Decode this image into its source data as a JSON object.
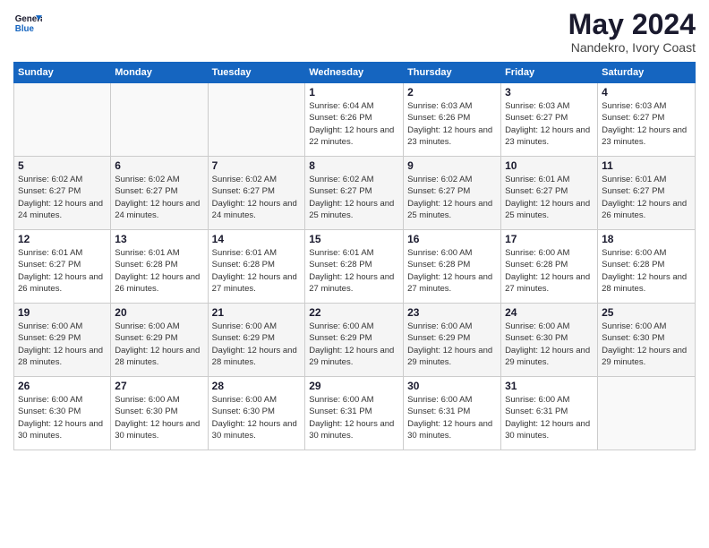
{
  "logo": {
    "text_general": "General",
    "text_blue": "Blue"
  },
  "header": {
    "month_year": "May 2024",
    "location": "Nandekro, Ivory Coast"
  },
  "weekdays": [
    "Sunday",
    "Monday",
    "Tuesday",
    "Wednesday",
    "Thursday",
    "Friday",
    "Saturday"
  ],
  "weeks": [
    [
      {
        "day": "",
        "sunrise": "",
        "sunset": "",
        "daylight": ""
      },
      {
        "day": "",
        "sunrise": "",
        "sunset": "",
        "daylight": ""
      },
      {
        "day": "",
        "sunrise": "",
        "sunset": "",
        "daylight": ""
      },
      {
        "day": "1",
        "sunrise": "Sunrise: 6:04 AM",
        "sunset": "Sunset: 6:26 PM",
        "daylight": "Daylight: 12 hours and 22 minutes."
      },
      {
        "day": "2",
        "sunrise": "Sunrise: 6:03 AM",
        "sunset": "Sunset: 6:26 PM",
        "daylight": "Daylight: 12 hours and 23 minutes."
      },
      {
        "day": "3",
        "sunrise": "Sunrise: 6:03 AM",
        "sunset": "Sunset: 6:27 PM",
        "daylight": "Daylight: 12 hours and 23 minutes."
      },
      {
        "day": "4",
        "sunrise": "Sunrise: 6:03 AM",
        "sunset": "Sunset: 6:27 PM",
        "daylight": "Daylight: 12 hours and 23 minutes."
      }
    ],
    [
      {
        "day": "5",
        "sunrise": "Sunrise: 6:02 AM",
        "sunset": "Sunset: 6:27 PM",
        "daylight": "Daylight: 12 hours and 24 minutes."
      },
      {
        "day": "6",
        "sunrise": "Sunrise: 6:02 AM",
        "sunset": "Sunset: 6:27 PM",
        "daylight": "Daylight: 12 hours and 24 minutes."
      },
      {
        "day": "7",
        "sunrise": "Sunrise: 6:02 AM",
        "sunset": "Sunset: 6:27 PM",
        "daylight": "Daylight: 12 hours and 24 minutes."
      },
      {
        "day": "8",
        "sunrise": "Sunrise: 6:02 AM",
        "sunset": "Sunset: 6:27 PM",
        "daylight": "Daylight: 12 hours and 25 minutes."
      },
      {
        "day": "9",
        "sunrise": "Sunrise: 6:02 AM",
        "sunset": "Sunset: 6:27 PM",
        "daylight": "Daylight: 12 hours and 25 minutes."
      },
      {
        "day": "10",
        "sunrise": "Sunrise: 6:01 AM",
        "sunset": "Sunset: 6:27 PM",
        "daylight": "Daylight: 12 hours and 25 minutes."
      },
      {
        "day": "11",
        "sunrise": "Sunrise: 6:01 AM",
        "sunset": "Sunset: 6:27 PM",
        "daylight": "Daylight: 12 hours and 26 minutes."
      }
    ],
    [
      {
        "day": "12",
        "sunrise": "Sunrise: 6:01 AM",
        "sunset": "Sunset: 6:27 PM",
        "daylight": "Daylight: 12 hours and 26 minutes."
      },
      {
        "day": "13",
        "sunrise": "Sunrise: 6:01 AM",
        "sunset": "Sunset: 6:28 PM",
        "daylight": "Daylight: 12 hours and 26 minutes."
      },
      {
        "day": "14",
        "sunrise": "Sunrise: 6:01 AM",
        "sunset": "Sunset: 6:28 PM",
        "daylight": "Daylight: 12 hours and 27 minutes."
      },
      {
        "day": "15",
        "sunrise": "Sunrise: 6:01 AM",
        "sunset": "Sunset: 6:28 PM",
        "daylight": "Daylight: 12 hours and 27 minutes."
      },
      {
        "day": "16",
        "sunrise": "Sunrise: 6:00 AM",
        "sunset": "Sunset: 6:28 PM",
        "daylight": "Daylight: 12 hours and 27 minutes."
      },
      {
        "day": "17",
        "sunrise": "Sunrise: 6:00 AM",
        "sunset": "Sunset: 6:28 PM",
        "daylight": "Daylight: 12 hours and 27 minutes."
      },
      {
        "day": "18",
        "sunrise": "Sunrise: 6:00 AM",
        "sunset": "Sunset: 6:28 PM",
        "daylight": "Daylight: 12 hours and 28 minutes."
      }
    ],
    [
      {
        "day": "19",
        "sunrise": "Sunrise: 6:00 AM",
        "sunset": "Sunset: 6:29 PM",
        "daylight": "Daylight: 12 hours and 28 minutes."
      },
      {
        "day": "20",
        "sunrise": "Sunrise: 6:00 AM",
        "sunset": "Sunset: 6:29 PM",
        "daylight": "Daylight: 12 hours and 28 minutes."
      },
      {
        "day": "21",
        "sunrise": "Sunrise: 6:00 AM",
        "sunset": "Sunset: 6:29 PM",
        "daylight": "Daylight: 12 hours and 28 minutes."
      },
      {
        "day": "22",
        "sunrise": "Sunrise: 6:00 AM",
        "sunset": "Sunset: 6:29 PM",
        "daylight": "Daylight: 12 hours and 29 minutes."
      },
      {
        "day": "23",
        "sunrise": "Sunrise: 6:00 AM",
        "sunset": "Sunset: 6:29 PM",
        "daylight": "Daylight: 12 hours and 29 minutes."
      },
      {
        "day": "24",
        "sunrise": "Sunrise: 6:00 AM",
        "sunset": "Sunset: 6:30 PM",
        "daylight": "Daylight: 12 hours and 29 minutes."
      },
      {
        "day": "25",
        "sunrise": "Sunrise: 6:00 AM",
        "sunset": "Sunset: 6:30 PM",
        "daylight": "Daylight: 12 hours and 29 minutes."
      }
    ],
    [
      {
        "day": "26",
        "sunrise": "Sunrise: 6:00 AM",
        "sunset": "Sunset: 6:30 PM",
        "daylight": "Daylight: 12 hours and 30 minutes."
      },
      {
        "day": "27",
        "sunrise": "Sunrise: 6:00 AM",
        "sunset": "Sunset: 6:30 PM",
        "daylight": "Daylight: 12 hours and 30 minutes."
      },
      {
        "day": "28",
        "sunrise": "Sunrise: 6:00 AM",
        "sunset": "Sunset: 6:30 PM",
        "daylight": "Daylight: 12 hours and 30 minutes."
      },
      {
        "day": "29",
        "sunrise": "Sunrise: 6:00 AM",
        "sunset": "Sunset: 6:31 PM",
        "daylight": "Daylight: 12 hours and 30 minutes."
      },
      {
        "day": "30",
        "sunrise": "Sunrise: 6:00 AM",
        "sunset": "Sunset: 6:31 PM",
        "daylight": "Daylight: 12 hours and 30 minutes."
      },
      {
        "day": "31",
        "sunrise": "Sunrise: 6:00 AM",
        "sunset": "Sunset: 6:31 PM",
        "daylight": "Daylight: 12 hours and 30 minutes."
      },
      {
        "day": "",
        "sunrise": "",
        "sunset": "",
        "daylight": ""
      }
    ]
  ]
}
